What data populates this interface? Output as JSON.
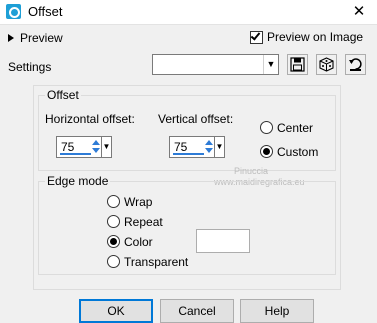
{
  "window": {
    "title": "Offset",
    "close_glyph": "✕"
  },
  "preview": {
    "toggle_label": "Preview",
    "on_image_label": "Preview on Image",
    "on_image_checked": true
  },
  "settings": {
    "label": "Settings",
    "selected_value": ""
  },
  "offset": {
    "legend": "Offset",
    "horizontal_label": "Horizontal offset:",
    "horizontal_value": "75",
    "vertical_label": "Vertical offset:",
    "vertical_value": "75",
    "options": [
      {
        "label": "Center",
        "selected": false
      },
      {
        "label": "Custom",
        "selected": true
      }
    ]
  },
  "edge_mode": {
    "legend": "Edge mode",
    "options": [
      {
        "label": "Wrap",
        "selected": false
      },
      {
        "label": "Repeat",
        "selected": false
      },
      {
        "label": "Color",
        "selected": true
      },
      {
        "label": "Transparent",
        "selected": false
      }
    ],
    "color_value": "#ffffff"
  },
  "buttons": {
    "ok": "OK",
    "cancel": "Cancel",
    "help": "Help"
  },
  "watermark": {
    "line1": "Pinuccia",
    "line2": "www.maidiregrafica.eu"
  },
  "icons": {
    "app": "offset-app-icon",
    "save": "save-icon",
    "randomize": "dice-icon",
    "reset": "reset-icon"
  },
  "colors": {
    "accent": "#2d7bd6",
    "default_button_border": "#0078d7"
  }
}
